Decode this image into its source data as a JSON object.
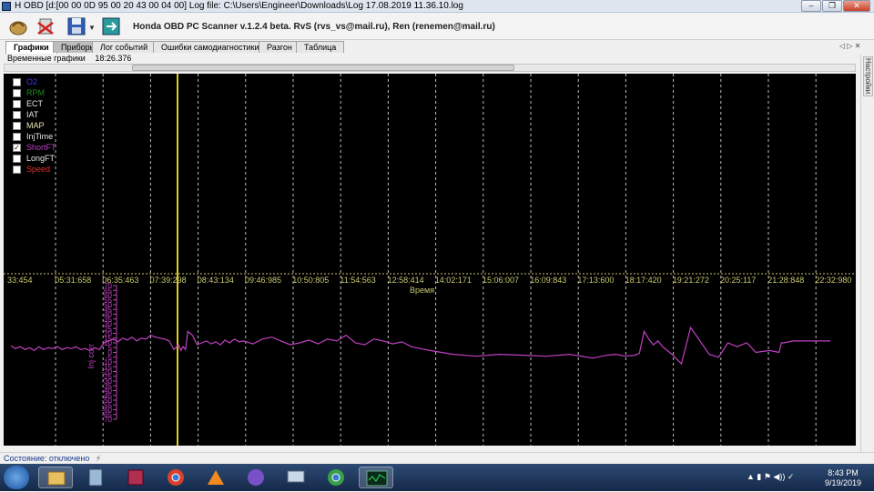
{
  "window": {
    "title": "H OBD [d:[00 00 0D 95 00 20 43 00 04 00] Log file: C:\\Users\\Engineer\\Downloads\\Log 17.08.2019 11.36.10.log",
    "controls": [
      "–",
      "❐",
      "✕"
    ]
  },
  "toolbar": {
    "app_title": "Honda OBD PC Scanner v.1.2.4 beta. RvS (rvs_vs@mail.ru), Ren (renemen@mail.ru)",
    "icons": [
      "connect-icon",
      "disconnect-icon",
      "save-icon",
      "dropdown-icon",
      "export-icon"
    ]
  },
  "tabs": [
    {
      "label": "Графики",
      "active": true
    },
    {
      "label": "Приборы",
      "active": false
    },
    {
      "label": "Лог событий",
      "active": false
    },
    {
      "label": "Ошибки самодиагностики",
      "active": false
    },
    {
      "label": "Разгон",
      "active": false
    },
    {
      "label": "Таблица",
      "active": false
    }
  ],
  "tab_nav": "◁ ▷ ✕",
  "subheader": {
    "label": "Временные графики",
    "time": "18:26.376"
  },
  "side_panel": {
    "label": "Настройки"
  },
  "legend": [
    {
      "label": "O2",
      "checked": false,
      "color": "#3a3aff"
    },
    {
      "label": "RPM",
      "checked": false,
      "color": "#1e8a1e"
    },
    {
      "label": "ECT",
      "checked": false,
      "color": "#e6e6e6"
    },
    {
      "label": "IAT",
      "checked": false,
      "color": "#e6e6e6"
    },
    {
      "label": "MAP",
      "checked": false,
      "color": "#e6e6b4"
    },
    {
      "label": "InjTime",
      "checked": false,
      "color": "#e6e6e6"
    },
    {
      "label": "ShortFT",
      "checked": true,
      "color": "#c040c0"
    },
    {
      "label": "LongFT",
      "checked": false,
      "color": "#e6e6e6"
    },
    {
      "label": "Speed",
      "checked": false,
      "color": "#e03030"
    }
  ],
  "chart_data": {
    "type": "line",
    "xlabel": "Время",
    "ylabel": "Inj corr",
    "x_ticks": [
      "33:454",
      "05:31:658",
      "06:35:463",
      "07:39:298",
      "08:43:134",
      "09:46:985",
      "10:50:805",
      "11:54:563",
      "12:58:414",
      "14:02:171",
      "15:06:007",
      "16:09:843",
      "17:13:600",
      "18:17:420",
      "19:21:272",
      "20:25:117",
      "21:28:848",
      "22:32:980"
    ],
    "y_ticks": [
      70,
      65,
      60,
      55,
      50,
      45,
      40,
      35,
      30,
      25,
      20,
      15,
      10,
      5,
      0,
      -5,
      -10,
      -15,
      -20,
      -25,
      -30,
      -35,
      -40,
      -45,
      -50,
      -55,
      -60,
      -65,
      -70
    ],
    "y_tick_labels": [
      "70",
      "65",
      "60",
      "55",
      "50",
      "45",
      "40",
      "35",
      "30",
      "25",
      "20",
      "15",
      "10",
      "5",
      "0",
      "-5",
      "-10",
      "-15",
      "-20",
      "-25",
      "-30",
      "-35",
      "-40",
      "-45",
      "-50",
      "-55",
      "-60",
      "-65",
      "-70"
    ],
    "ylim": [
      -70,
      70
    ],
    "xlim": [
      0,
      17.6
    ],
    "grid": "vertical dashed",
    "series": [
      {
        "name": "ShortFT",
        "color": "#c040c0",
        "x": [
          0,
          0.1,
          0.2,
          0.3,
          0.4,
          0.5,
          0.6,
          0.7,
          0.8,
          0.9,
          1.0,
          1.1,
          1.2,
          1.3,
          1.4,
          1.5,
          1.6,
          1.7,
          1.8,
          1.9,
          2.0,
          2.1,
          2.2,
          2.3,
          2.4,
          2.5,
          2.6,
          2.7,
          2.8,
          2.9,
          3.0,
          3.1,
          3.2,
          3.3,
          3.4,
          3.5,
          3.6,
          3.65,
          3.7,
          3.75,
          3.8,
          3.9,
          4.0,
          4.1,
          4.2,
          4.3,
          4.4,
          4.5,
          4.6,
          4.7,
          4.8,
          4.9,
          5.0,
          5.2,
          5.4,
          5.6,
          5.8,
          6.0,
          6.2,
          6.4,
          6.6,
          6.8,
          7.0,
          7.2,
          7.4,
          7.6,
          7.8,
          8.0,
          8.2,
          8.4,
          8.6,
          8.8,
          9.0,
          9.5,
          10.0,
          10.5,
          11.0,
          11.5,
          12.0,
          12.5,
          12.8,
          13.0,
          13.2,
          13.4,
          13.5,
          13.6,
          13.7,
          13.8,
          13.9,
          14.0,
          14.2,
          14.4,
          14.6,
          14.8,
          15.0,
          15.2,
          15.4,
          15.6,
          15.8,
          15.85,
          16.0,
          16.3,
          16.5,
          16.55,
          16.6,
          16.8,
          17.0,
          17.6
        ],
        "values": [
          7,
          4,
          6,
          3,
          5,
          2,
          6,
          3,
          5,
          4,
          6,
          3,
          5,
          4,
          6,
          3,
          4,
          2,
          5,
          3,
          10,
          12,
          14,
          11,
          15,
          13,
          16,
          12,
          15,
          14,
          18,
          16,
          15,
          14,
          12,
          3,
          8,
          2,
          6,
          3,
          22,
          18,
          8,
          10,
          12,
          9,
          11,
          8,
          13,
          10,
          14,
          11,
          12,
          9,
          14,
          16,
          12,
          8,
          10,
          13,
          9,
          14,
          12,
          18,
          10,
          8,
          14,
          12,
          9,
          11,
          6,
          4,
          2,
          -2,
          -4,
          -2,
          -3,
          -4,
          -2,
          -6,
          -3,
          -2,
          -4,
          -3,
          -1,
          22,
          14,
          8,
          12,
          6,
          -2,
          -12,
          26,
          12,
          -2,
          -5,
          10,
          6,
          10,
          8,
          0,
          2,
          0,
          10,
          10,
          12,
          12,
          12
        ]
      }
    ]
  },
  "statusbar": {
    "state": "Состояние: отключено"
  },
  "taskbar": {
    "apps": [
      "start-button",
      "explorer-icon",
      "calculator-icon",
      "winrar-icon",
      "chrome-icon",
      "avast-icon",
      "viber-icon",
      "network-icon",
      "chrome-icon-2",
      "obd-scanner-icon"
    ],
    "clock_time": "8:43 PM",
    "clock_date": "9/19/2019"
  }
}
